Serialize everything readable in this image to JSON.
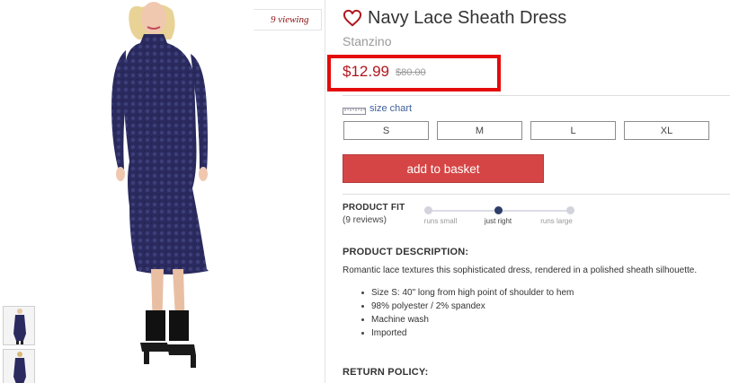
{
  "gallery": {
    "viewing_tag": "9 viewing",
    "main_image": "navy-lace-dress-photo",
    "thumbnails": [
      "thumbnail-front",
      "thumbnail-back"
    ]
  },
  "product": {
    "title": "Navy Lace Sheath Dress",
    "brand": "Stanzino",
    "price": "$12.99",
    "old_price": "$80.00",
    "favorite_icon": "heart-outline-icon",
    "accent_color": "#b0161f",
    "highlight_color": "#e40b0b"
  },
  "sizes": {
    "chart_label": "size chart",
    "chart_icon": "ruler-icon",
    "options": [
      "S",
      "M",
      "L",
      "XL"
    ]
  },
  "basket": {
    "label": "add to basket",
    "color": "#d64545"
  },
  "fit": {
    "heading": "PRODUCT FIT",
    "reviews": "(9 reviews)",
    "labels": [
      "runs small",
      "just right",
      "runs large"
    ],
    "selected": "just right"
  },
  "description": {
    "heading": "PRODUCT DESCRIPTION:",
    "text": "Romantic lace textures this sophisticated dress, rendered in a polished sheath silhouette.",
    "bullets": [
      "Size S: 40\" long from high point of shoulder to hem",
      "98% polyester / 2% spandex",
      "Machine wash",
      "Imported"
    ]
  },
  "return_policy": {
    "heading": "RETURN POLICY:"
  }
}
